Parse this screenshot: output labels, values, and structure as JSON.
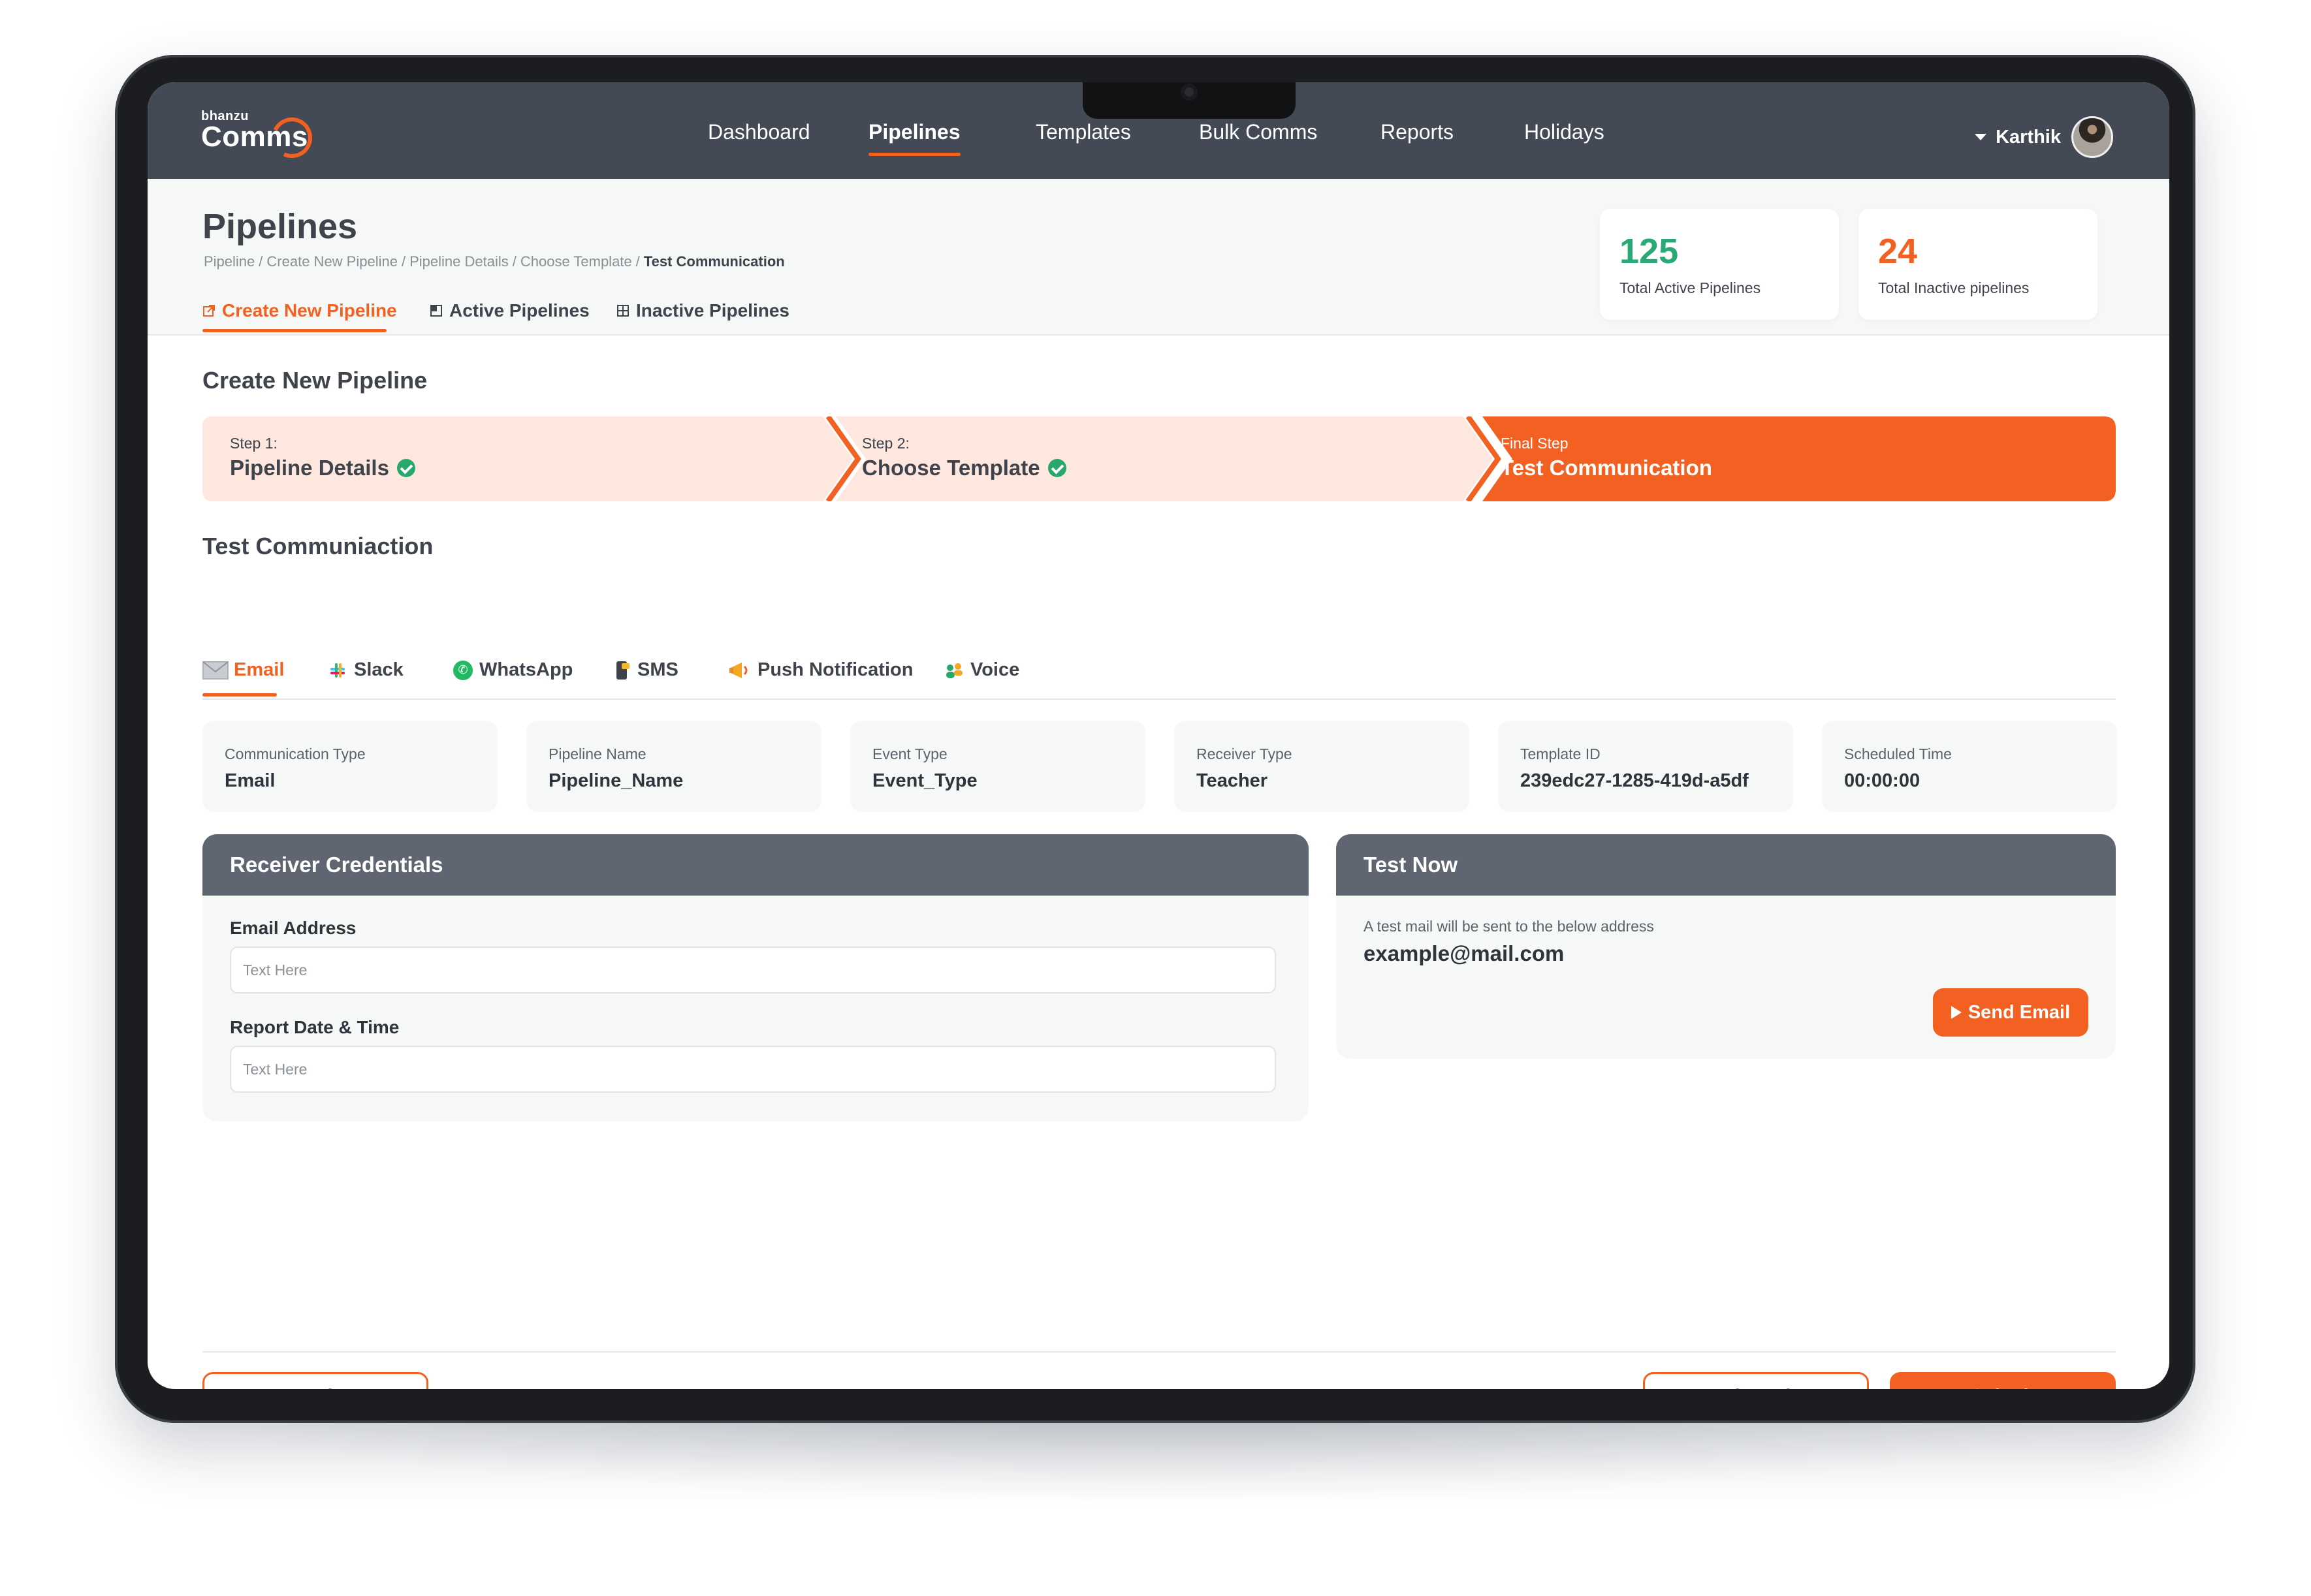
{
  "app": {
    "logo_small": "bhanzu",
    "logo_big": "Comms"
  },
  "nav": {
    "items": [
      "Dashboard",
      "Pipelines",
      "Templates",
      "Bulk Comms",
      "Reports",
      "Holidays"
    ],
    "active": "Pipelines",
    "user_name": "Karthik"
  },
  "header": {
    "title": "Pipelines",
    "breadcrumb": [
      "Pipeline",
      "Create New Pipeline",
      "Pipeline Details",
      "Choose Template",
      "Test Communication"
    ],
    "tabs": [
      "Create New Pipeline",
      "Active Pipelines",
      "Inactive Pipelines"
    ],
    "active_tab": "Create New Pipeline",
    "stats": [
      {
        "value": "125",
        "label": "Total Active Pipelines",
        "color": "#2aa876"
      },
      {
        "value": "24",
        "label": "Total Inactive pipelines",
        "color": "#f26122"
      }
    ]
  },
  "create": {
    "title": "Create New Pipeline",
    "steps": [
      {
        "label": "Step 1:",
        "name": "Pipeline Details",
        "done": true
      },
      {
        "label": "Step 2:",
        "name": "Choose Template",
        "done": true
      },
      {
        "label": "Final Step",
        "name": "Test Communication",
        "current": true
      }
    ]
  },
  "test": {
    "title": "Test Communiaction",
    "channels": [
      "Email",
      "Slack",
      "WhatsApp",
      "SMS",
      "Push Notification",
      "Voice"
    ],
    "active_channel": "Email",
    "info": [
      {
        "label": "Communication Type",
        "value": "Email"
      },
      {
        "label": "Pipeline Name",
        "value": "Pipeline_Name"
      },
      {
        "label": "Event Type",
        "value": "Event_Type"
      },
      {
        "label": "Receiver Type",
        "value": "Teacher"
      },
      {
        "label": "Template ID",
        "value": "239edc27-1285-419d-a5df"
      },
      {
        "label": "Scheduled Time",
        "value": "00:00:00"
      }
    ]
  },
  "receiver": {
    "title": "Receiver Credentials",
    "email_label": "Email Address",
    "email_placeholder": "Text Here",
    "date_label": "Report Date & Time",
    "date_placeholder": "Text Here"
  },
  "test_now": {
    "title": "Test Now",
    "note": "A test mail will be sent to the below address",
    "address": "example@mail.com",
    "send_label": "Send Email"
  },
  "footer": {
    "back": "Back",
    "discard": "Discard",
    "submit": "Submit"
  },
  "colors": {
    "accent": "#f26122",
    "step_done_bg": "#fde7de",
    "nav_bg": "#434955",
    "panel_head": "#5f6571",
    "success": "#28a86b"
  }
}
